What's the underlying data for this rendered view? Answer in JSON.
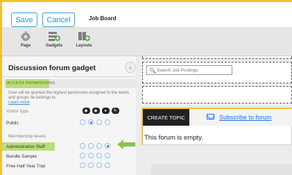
{
  "toolbar": {
    "save_label": "Save",
    "cancel_label": "Cancel",
    "title": "Job Board"
  },
  "tools": [
    {
      "label": "Page",
      "icon": "gear-icon"
    },
    {
      "label": "Gadgets",
      "icon": "gadget-add-icon"
    },
    {
      "label": "Layouts",
      "icon": "layout-add-icon"
    }
  ],
  "panel": {
    "title": "Discussion forum gadget",
    "section": "ACCESS PERMISSIONS",
    "description": "User will be granted the highest permission assigned to the levels and groups he belongs to.",
    "learn_more": "Learn more",
    "visitor_type_label": "Visitor type",
    "membership_label": "Membership levels",
    "rows": [
      {
        "label": "Public",
        "selected": 1
      },
      {
        "label": "Administrative Staff",
        "selected": 3
      },
      {
        "label": "Bundle Sample",
        "selected": null
      },
      {
        "label": "Free Half-Year Trial",
        "selected": null
      }
    ]
  },
  "search": {
    "placeholder": "Search Job Postings"
  },
  "forum": {
    "create_topic": "CREATE TOPIC",
    "subscribe": "Subscribe to forum",
    "empty_text": "This forum is empty."
  },
  "colors": {
    "accent_yellow": "#f2c12e",
    "highlight_green": "#b9de7c",
    "link_blue": "#1a73e8"
  }
}
